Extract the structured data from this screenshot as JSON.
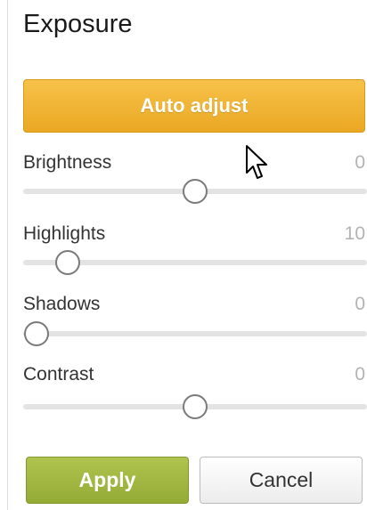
{
  "panel": {
    "title": "Exposure"
  },
  "auto_adjust": {
    "label": "Auto adjust"
  },
  "sliders": [
    {
      "label": "Brightness",
      "value": "0",
      "level": 0.5
    },
    {
      "label": "Highlights",
      "value": "10",
      "level": 0.13
    },
    {
      "label": "Shadows",
      "value": "0",
      "level": 0.04
    },
    {
      "label": "Contrast",
      "value": "0",
      "level": 0.5
    }
  ],
  "actions": {
    "apply_label": "Apply",
    "cancel_label": "Cancel"
  },
  "colors": {
    "auto_adjust_button": "#eaa823",
    "apply_button": "#94ab36",
    "track": "#e3e3e3"
  },
  "icons": {
    "cursor": "mouse-pointer-icon"
  }
}
